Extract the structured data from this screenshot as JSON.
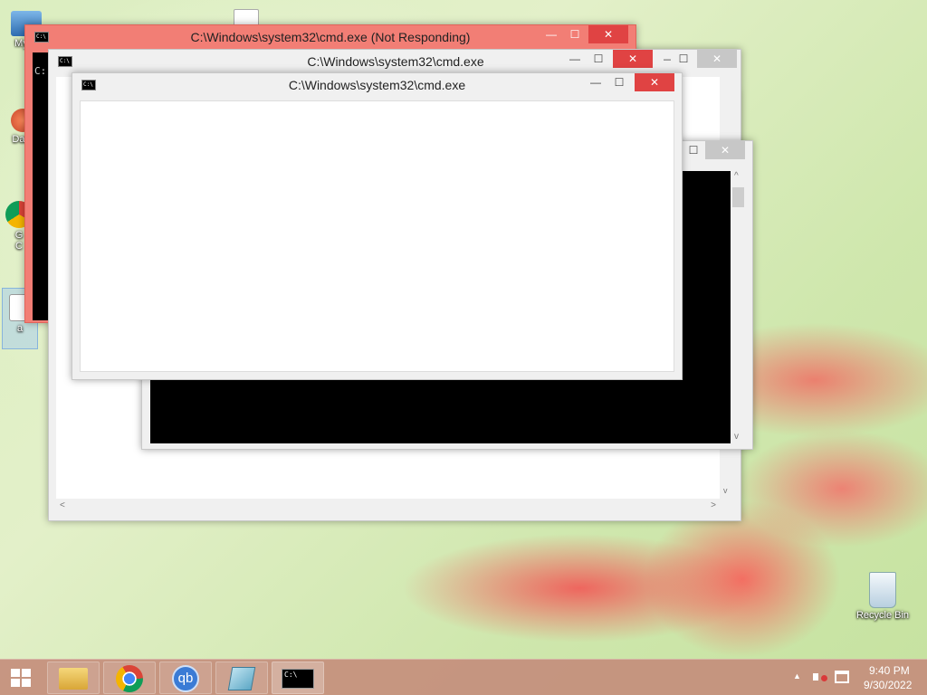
{
  "desktop": {
    "icons": [
      {
        "label": "My C",
        "icon": "computer-icon"
      },
      {
        "label": "Data",
        "icon": "data-icon"
      },
      {
        "label": "G",
        "icon": "chrome-shortcut-icon"
      },
      {
        "label": "C",
        "icon": "chrome-shortcut-icon"
      },
      {
        "label": "a",
        "icon": "file-icon"
      }
    ],
    "recycle_bin": "Recycle Bin"
  },
  "windows": {
    "w1_title": "C:\\Windows\\system32\\cmd.exe (Not Responding)",
    "w2_title": "C:\\Windows\\system32\\cmd.exe",
    "w3_title": "C:\\Windows\\system32\\cmd.exe",
    "cmd_icon_text": "C:\\",
    "prompt_fragment": "C:",
    "minimize": "—",
    "maximize": "☐",
    "close": "✕",
    "scroll_up": "^",
    "scroll_down": "v",
    "scroll_left": "<",
    "scroll_right": ">"
  },
  "taskbar": {
    "start": "start-icon",
    "apps": [
      "file-explorer-icon",
      "chrome-icon",
      "qbittorrent-icon",
      "notepad-icon",
      "cmd-icon"
    ],
    "qb_text": "qb",
    "tray_arrow": "▲",
    "time": "9:40 PM",
    "date": "9/30/2022"
  },
  "colors": {
    "not_responding_frame": "#f27e75",
    "close_red": "#e04343",
    "taskbar": "#c48e7c"
  }
}
